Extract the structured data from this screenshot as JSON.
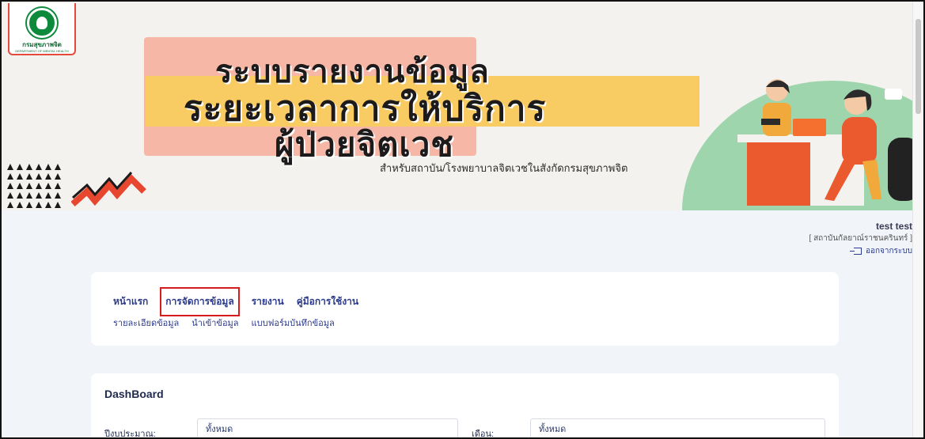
{
  "banner": {
    "logo_text": "กรมสุขภาพจิต",
    "logo_subtext": "DEPARTMENT OF MENTAL HEALTH",
    "title_line1": "ระบบรายงานข้อมูล",
    "title_line2": "ระยะเวลาการให้บริการ",
    "title_line3": "ผู้ป่วยจิตเวช",
    "subtitle": "สำหรับสถาบัน/โรงพยาบาลจิตเวชในสังกัดกรมสุขภาพจิต"
  },
  "user": {
    "name": "test test",
    "organization": "[ สถาบันกัลยาณ์ราชนครินทร์ ]",
    "logout_label": "ออกจากระบบ"
  },
  "nav": {
    "main": [
      {
        "label": "หน้าแรก",
        "active": false
      },
      {
        "label": "การจัดการข้อมูล",
        "active": true
      },
      {
        "label": "รายงาน",
        "active": false
      },
      {
        "label": "คู่มือการใช้งาน",
        "active": false
      }
    ],
    "sub": [
      {
        "label": "รายละเอียดข้อมูล"
      },
      {
        "label": "นำเข้าข้อมูล"
      },
      {
        "label": "แบบฟอร์มบันทึกข้อมูล"
      }
    ]
  },
  "dashboard": {
    "title": "DashBoard",
    "fiscal_year_label": "ปีงบประมาณ:",
    "fiscal_year_value": "ทั้งหมด",
    "month_label": "เดือน:",
    "month_value": "ทั้งหมด"
  },
  "colors": {
    "accent": "#2b3a8c",
    "highlight_border": "#d61c1c",
    "banner_yellow": "#f9cb63",
    "banner_pink": "#f6b7a6",
    "banner_green": "#9fd5ac"
  }
}
